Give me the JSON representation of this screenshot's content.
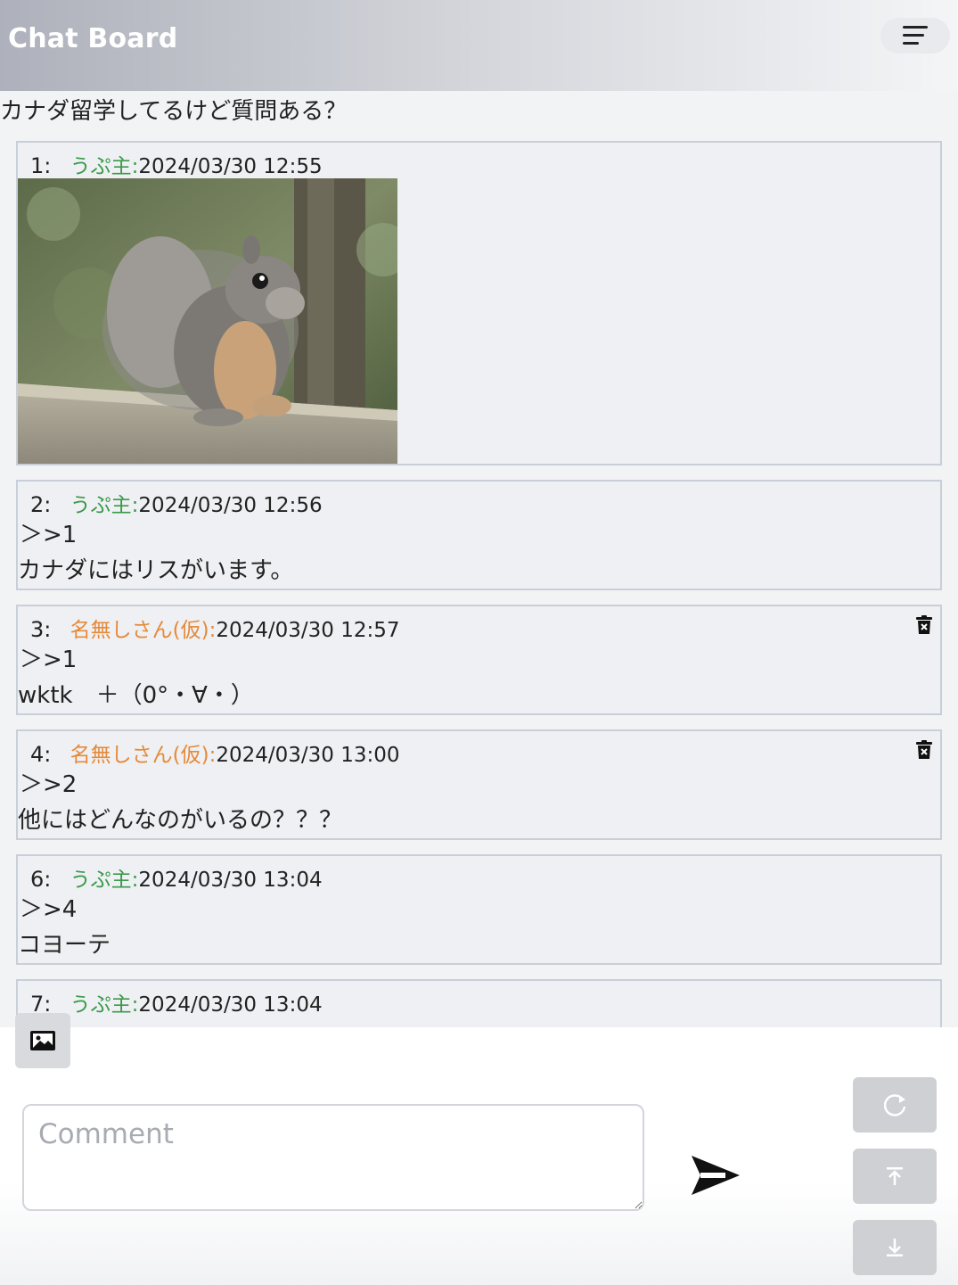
{
  "header": {
    "title": "Chat Board"
  },
  "thread": {
    "title": "カナダ留学してるけど質問ある？"
  },
  "posts": [
    {
      "num": "1:",
      "author": "うぷ主:",
      "timestamp": "2024/03/30 12:55"
    },
    {
      "num": "2:",
      "author": "うぷ主:",
      "timestamp": "2024/03/30 12:56",
      "line1": "＞>1",
      "line2": "カナダにはリスがいます。"
    },
    {
      "num": "3:",
      "author": "名無しさん(仮):",
      "timestamp": "2024/03/30 12:57",
      "line1": "＞>1",
      "line2": "wktk　＋（0°・∀・）"
    },
    {
      "num": "4:",
      "author": "名無しさん(仮):",
      "timestamp": "2024/03/30 13:00",
      "line1": "＞>2",
      "line2": "他にはどんなのがいるの？？？"
    },
    {
      "num": "6:",
      "author": "うぷ主:",
      "timestamp": "2024/03/30 13:04",
      "line1": "＞>4",
      "line2": "コヨーテ"
    },
    {
      "num": "7:",
      "author": "うぷ主:",
      "timestamp": "2024/03/30 13:04"
    }
  ],
  "composer": {
    "placeholder": "Comment",
    "value": ""
  },
  "colors": {
    "op_author": "#3a9a4a",
    "anon_author": "#e58a3a"
  },
  "icons": {
    "menu": "menu-icon",
    "delete": "trash-icon",
    "image": "image-icon",
    "send": "send-icon",
    "reload": "reload-icon",
    "top": "scroll-top-icon",
    "bottom": "scroll-bottom-icon"
  }
}
